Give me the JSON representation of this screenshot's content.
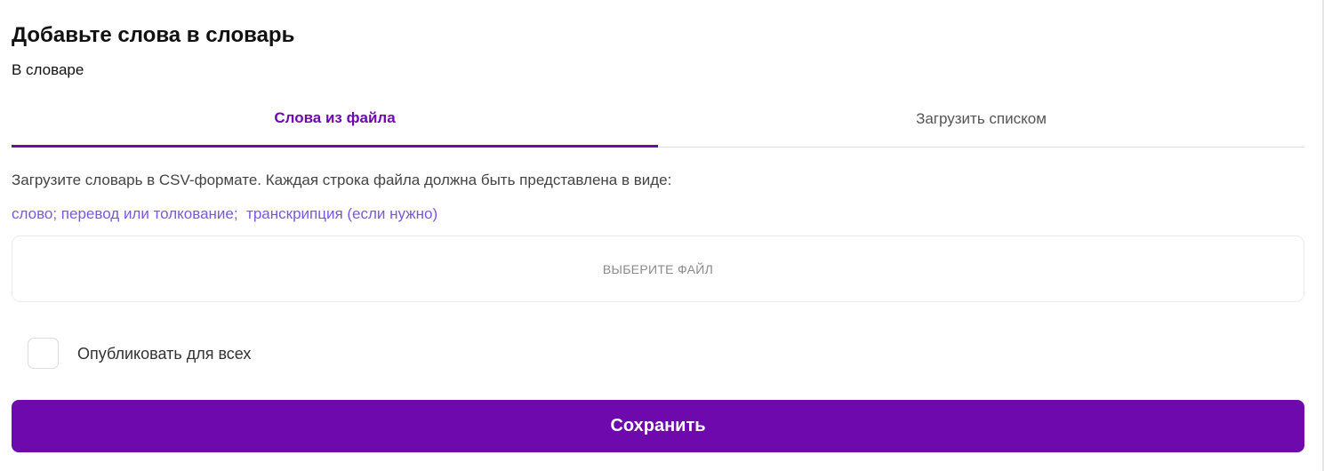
{
  "header": {
    "title": "Добавьте слова в словарь",
    "subtitle": "В словаре"
  },
  "tabs": [
    {
      "label": "Слова из файла",
      "active": true
    },
    {
      "label": "Загрузить списком",
      "active": false
    }
  ],
  "upload": {
    "description": "Загрузите словарь в CSV-формате. Каждая строка файла должна быть представлена в виде:",
    "format_line": "слово; перевод или толкование;  транскрипция (если нужно)",
    "choose_file_label": "ВЫБЕРИТЕ ФАЙЛ"
  },
  "publish": {
    "label": "Опубликовать для всех",
    "checked": false
  },
  "actions": {
    "save_label": "Сохранить"
  },
  "colors": {
    "accent": "#6e0aad",
    "format_text": "#7b57e0"
  }
}
